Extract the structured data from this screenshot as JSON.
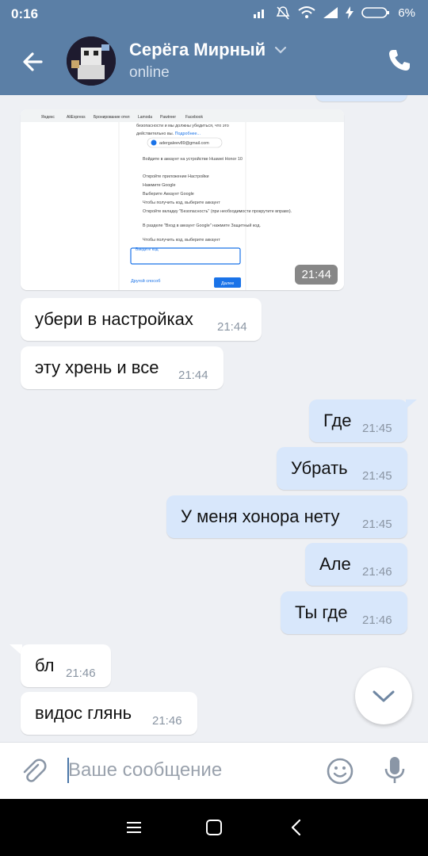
{
  "status": {
    "time": "0:16",
    "battery": "6%"
  },
  "header": {
    "name": "Серёга Мирный",
    "status": "online"
  },
  "screenshot_message": {
    "time": "21:44",
    "bookmarks": [
      "Яндекс",
      "AliExpress",
      "Бронирование отел",
      "Lamoda",
      "Pawtreer",
      "Facebook"
    ],
    "lines": [
      "безопасности и мы должны убедиться, что это",
      "действительно вы.",
      "adergaleev89@gmail.com",
      "Войдите в аккаунт на устройстве Huawei Honor 10",
      "Откройте приложение Настройки",
      "Нажмите Google",
      "Выберите Аккаунт Google",
      "Чтобы получить код, выберите аккаунт",
      "Откройте вкладку \"Безопасность\" (при необходимости прокрутите вправо).",
      "В разделе \"Вход в аккаунт Google\" нажмите Защитный код.",
      "Чтобы получить код, выберите аккаунт"
    ],
    "more_link": "Подробнее...",
    "input_label": "Введите код",
    "other_link": "Другой способ",
    "next_button": "Далее"
  },
  "messages": [
    {
      "dir": "in",
      "text": "убери в настройках",
      "time": "21:44"
    },
    {
      "dir": "in",
      "text": "эту хрень и все",
      "time": "21:44"
    },
    {
      "dir": "out",
      "text": "Где",
      "time": "21:45"
    },
    {
      "dir": "out",
      "text": "Убрать",
      "time": "21:45"
    },
    {
      "dir": "out",
      "text": "У меня хонора нету",
      "time": "21:45"
    },
    {
      "dir": "out",
      "text": "Але",
      "time": "21:46"
    },
    {
      "dir": "out",
      "text": "Ты где",
      "time": "21:46"
    },
    {
      "dir": "in",
      "text": "бл",
      "time": "21:46"
    },
    {
      "dir": "in",
      "text": "видос глянь",
      "time": "21:46"
    }
  ],
  "composer": {
    "placeholder": "Ваше сообщение"
  },
  "colors": {
    "accent": "#5b7fa6",
    "incoming": "#ffffff",
    "outgoing": "#d8e7fb"
  },
  "icons": [
    "back-arrow-icon",
    "chevron-down-icon",
    "phone-icon",
    "scroll-down-icon",
    "paperclip-icon",
    "emoji-icon",
    "microphone-icon"
  ]
}
